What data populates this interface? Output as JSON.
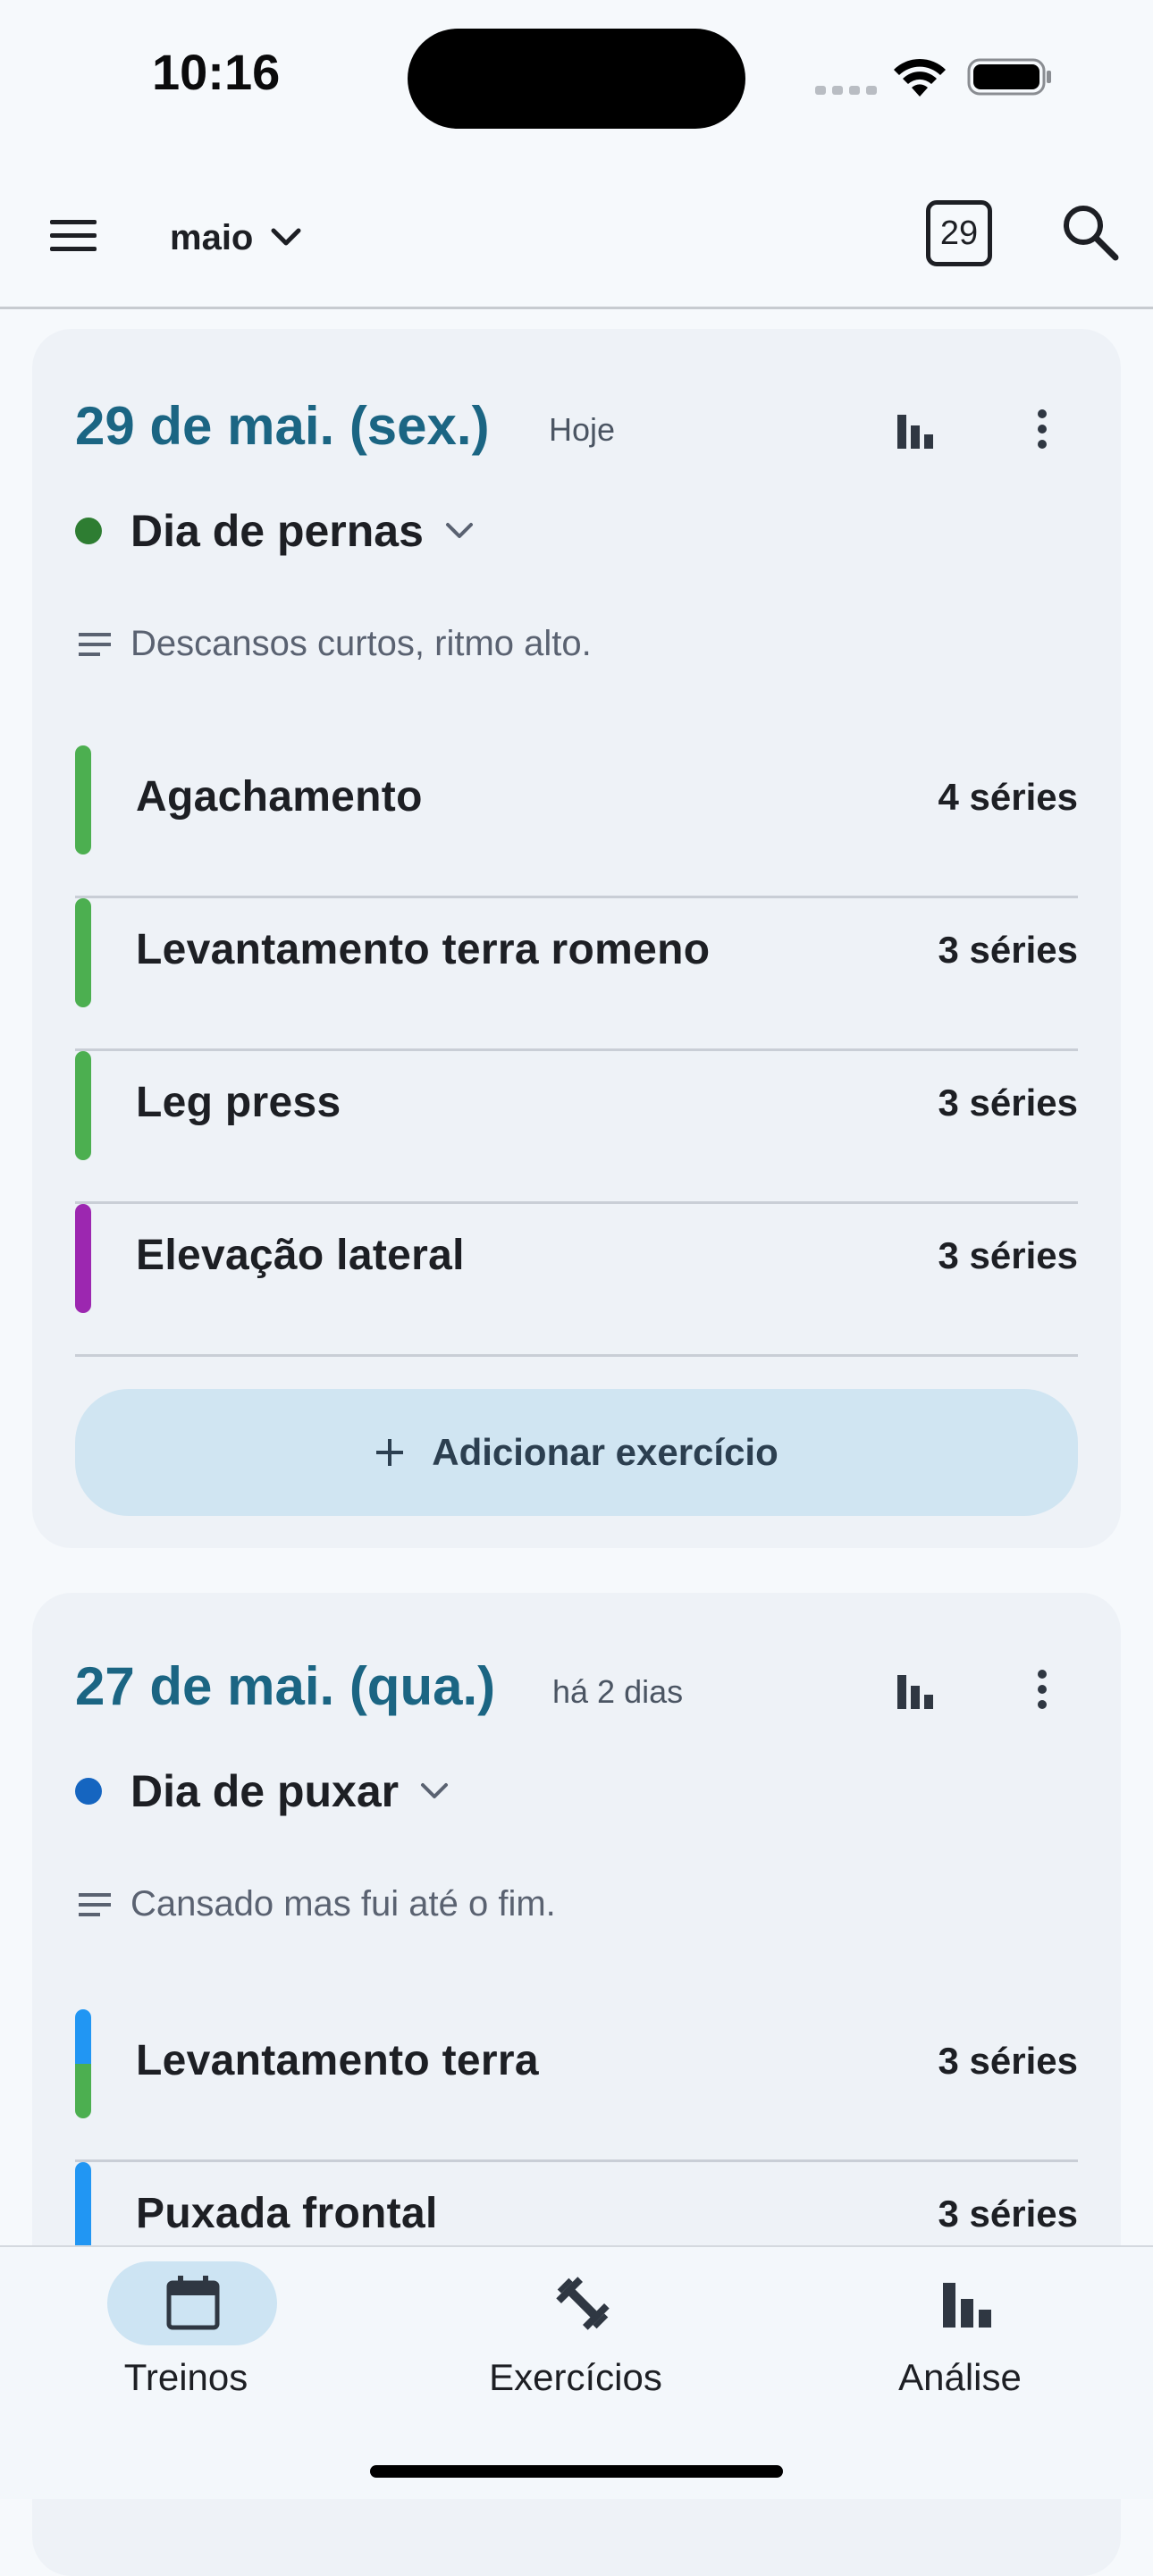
{
  "status_bar": {
    "time": "10:16"
  },
  "app_bar": {
    "month": "maio",
    "today_day": "29"
  },
  "workouts": [
    {
      "date": "29 de mai. (sex.)",
      "relative": "Hoje",
      "routine": "Dia de pernas",
      "routine_color": "#2e7d32",
      "note": "Descansos curtos, ritmo alto.",
      "exercises": [
        {
          "name": "Agachamento",
          "sets": "4 séries",
          "colors": [
            "#4caf50"
          ]
        },
        {
          "name": "Levantamento terra romeno",
          "sets": "3 séries",
          "colors": [
            "#4caf50"
          ]
        },
        {
          "name": "Leg press",
          "sets": "3 séries",
          "colors": [
            "#4caf50"
          ]
        },
        {
          "name": "Elevação lateral",
          "sets": "3 séries",
          "colors": [
            "#9c27b0"
          ]
        }
      ],
      "add_label": "Adicionar exercício"
    },
    {
      "date": "27 de mai. (qua.)",
      "relative": "há 2 dias",
      "routine": "Dia de puxar",
      "routine_color": "#1565c0",
      "note": "Cansado mas fui até o fim.",
      "exercises": [
        {
          "name": "Levantamento terra",
          "sets": "3 séries",
          "colors": [
            "#2196f3",
            "#4caf50"
          ]
        },
        {
          "name": "Puxada frontal",
          "sets": "3 séries",
          "colors": [
            "#2196f3"
          ]
        }
      ]
    }
  ],
  "bottom_nav": {
    "items": [
      {
        "label": "Treinos",
        "icon": "calendar-icon",
        "active": true
      },
      {
        "label": "Exercícios",
        "icon": "dumbbell-icon",
        "active": false
      },
      {
        "label": "Análise",
        "icon": "bar-chart-icon",
        "active": false
      }
    ]
  },
  "colors": {
    "accent": "#1b6583",
    "card_bg": "#eef2f7",
    "active_pill": "#cde4f3"
  }
}
